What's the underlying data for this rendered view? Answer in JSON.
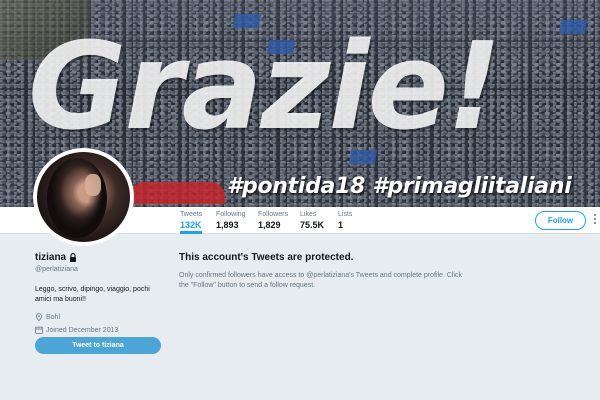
{
  "banner": {
    "headline": "Grazie!",
    "hashtags": "#pontida18 #primagliitaliani"
  },
  "nav": {
    "stats": [
      {
        "label": "Tweets",
        "value": "132K"
      },
      {
        "label": "Following",
        "value": "1,893"
      },
      {
        "label": "Followers",
        "value": "1,829"
      },
      {
        "label": "Likes",
        "value": "75.5K"
      },
      {
        "label": "Lists",
        "value": "1"
      }
    ],
    "follow_label": "Follow"
  },
  "profile": {
    "name": "tiziana",
    "handle": "@perlatiziana",
    "bio": "Leggo, scrivo, dipingo, viaggio, pochi amici ma buoni!!",
    "location": "Bohl",
    "joined": "Joined December 2013",
    "tweet_to_label": "Tweet to tiziana"
  },
  "protected": {
    "title": "This account's Tweets are protected.",
    "body": "Only confirmed followers have access to @perlatiziana's Tweets and complete profile. Click the \"Follow\" button to send a follow request."
  },
  "colors": {
    "accent": "#1da1f2",
    "tweet_button": "#4ba5d6",
    "background": "#e6ecf0"
  }
}
